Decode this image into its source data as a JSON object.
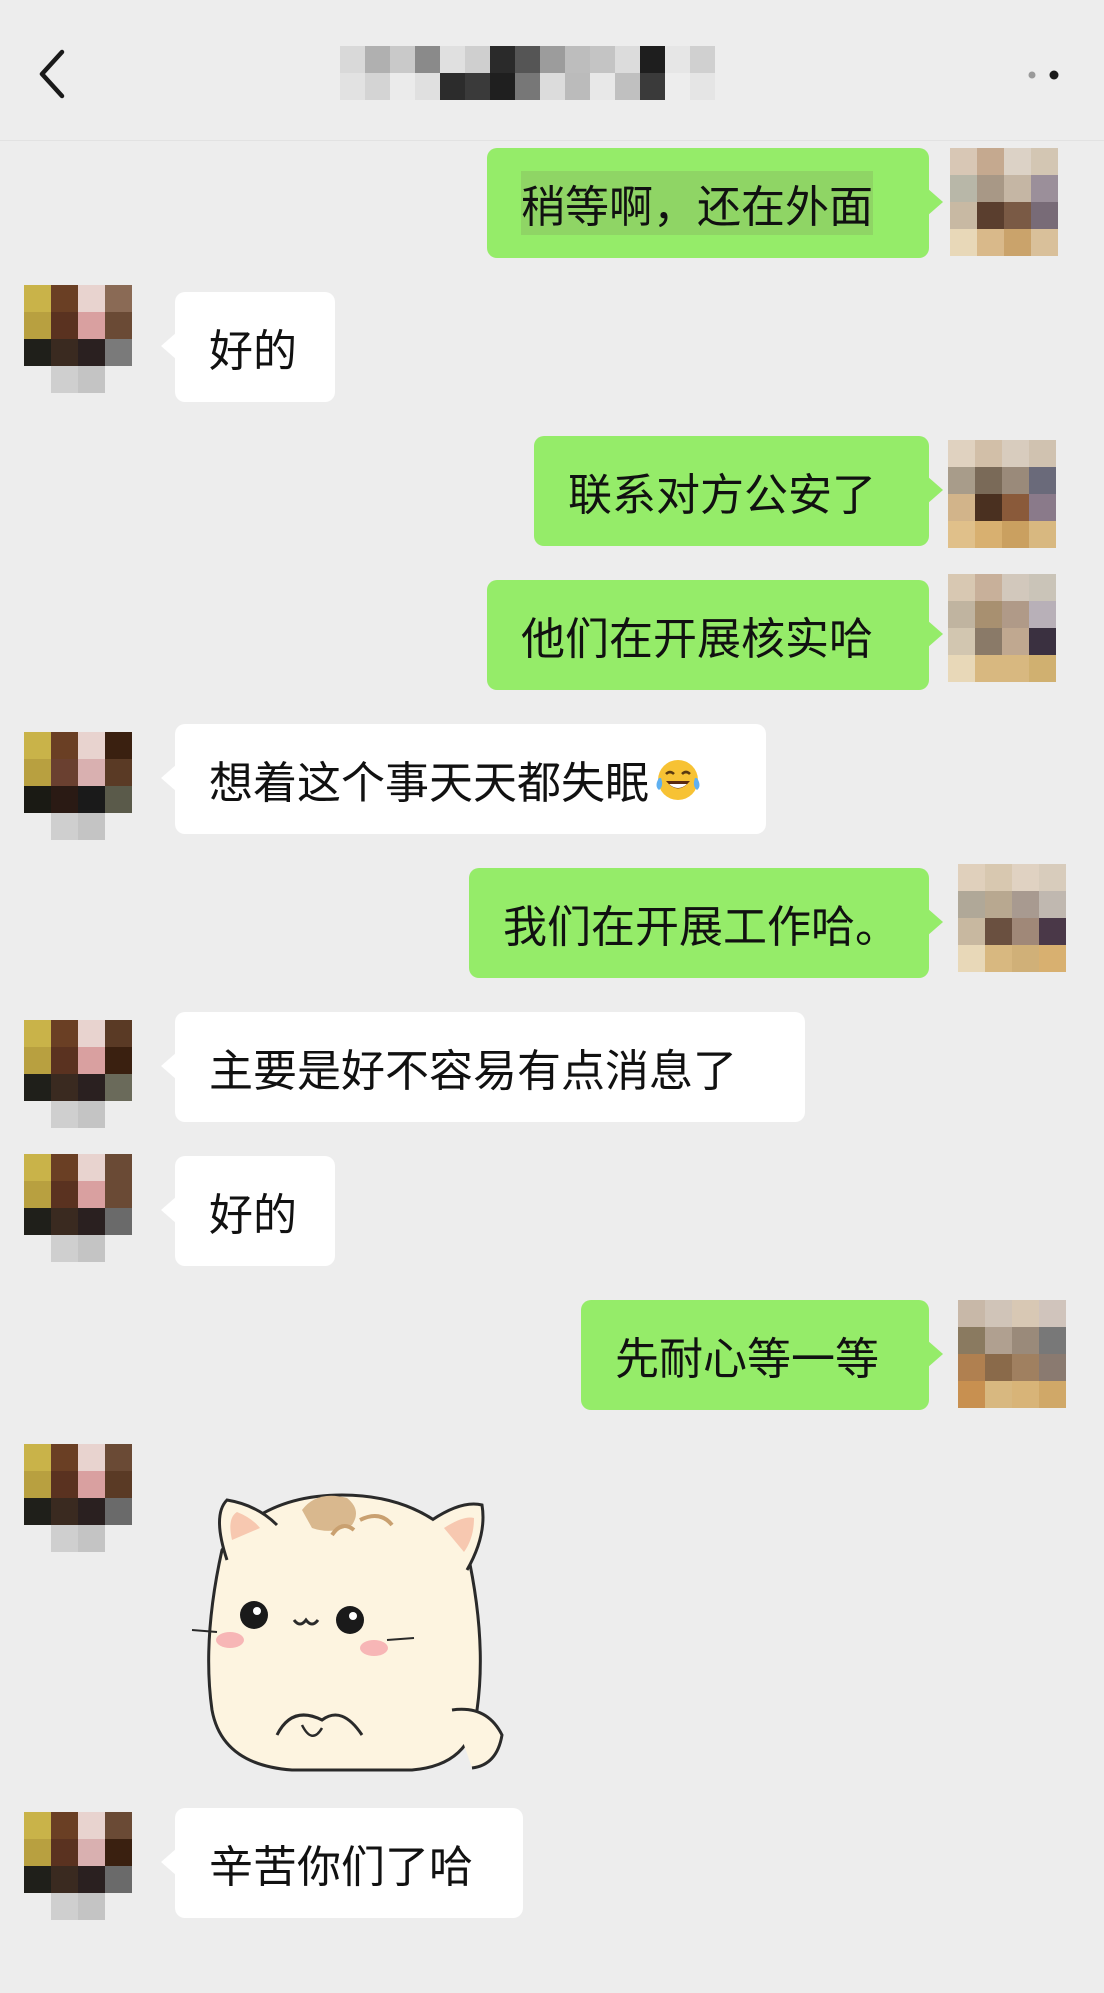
{
  "header": {
    "title": "",
    "back_icon": "chevron-left-icon",
    "more_icon": "more-dots-icon"
  },
  "messages": [
    {
      "side": "sent",
      "text_pre": "",
      "text_hl": "稍等啊，还在外面"
    },
    {
      "side": "recv",
      "text": "好的"
    },
    {
      "side": "sent",
      "text": "联系对方公安了"
    },
    {
      "side": "sent",
      "text": "他们在开展核实哈"
    },
    {
      "side": "recv",
      "text": "想着这个事天天都失眠",
      "emoji": "tears-of-joy-emoji"
    },
    {
      "side": "sent",
      "text": "我们在开展工作哈。"
    },
    {
      "side": "recv",
      "text": "主要是好不容易有点消息了"
    },
    {
      "side": "recv",
      "text": "好的"
    },
    {
      "side": "sent",
      "text": "先耐心等一等"
    },
    {
      "side": "recv",
      "sticker": "cat-sticker"
    },
    {
      "side": "recv",
      "text": "辛苦你们了哈"
    }
  ],
  "colors": {
    "background": "#ededed",
    "sent_bubble": "#95ec69",
    "recv_bubble": "#ffffff"
  }
}
